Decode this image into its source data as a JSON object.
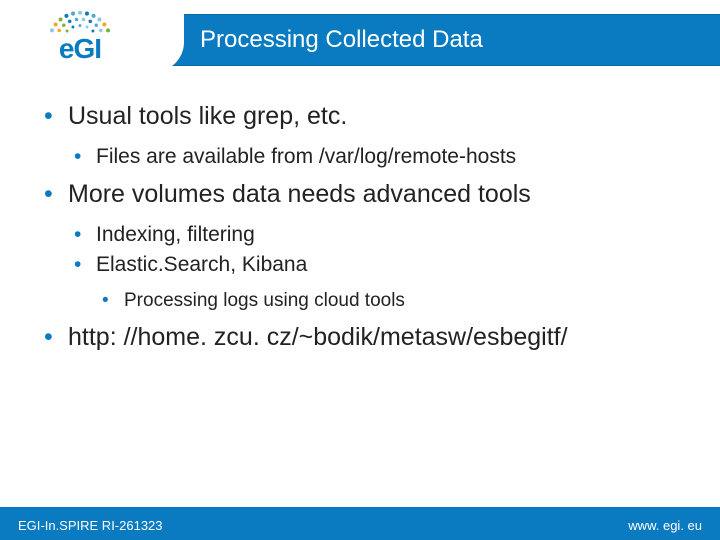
{
  "header": {
    "logo_text": "eGI",
    "title": "Processing Collected Data"
  },
  "bullets": [
    {
      "text": "Usual tools like grep, etc.",
      "children": [
        {
          "text": "Files are available from /var/log/remote-hosts"
        }
      ]
    },
    {
      "text": "More volumes data needs advanced tools",
      "children": [
        {
          "text": "Indexing, filtering"
        },
        {
          "text": "Elastic.Search, Kibana",
          "children": [
            {
              "text": "Processing logs using cloud tools"
            }
          ]
        }
      ]
    },
    {
      "text": "http: //home. zcu. cz/~bodik/metasw/esbegitf/"
    }
  ],
  "footer": {
    "left": "EGI-In.SPIRE RI-261323",
    "right": "www. egi. eu"
  },
  "logo_dots": {
    "colors": [
      "#0b7bc1",
      "#4fa8d8",
      "#8cc8e8",
      "#f5a623",
      "#7bb342",
      "#0b7bc1",
      "#4fa8d8",
      "#8cc8e8"
    ],
    "rows": [
      [
        0,
        1,
        2,
        3,
        4,
        5,
        6,
        7,
        8,
        9,
        10,
        11,
        12,
        13,
        14
      ],
      [
        1,
        2,
        3,
        4,
        5,
        6,
        7,
        8,
        9,
        10,
        11,
        12,
        13
      ],
      [
        3,
        4,
        5,
        6,
        7,
        8,
        9,
        10,
        11
      ]
    ]
  }
}
